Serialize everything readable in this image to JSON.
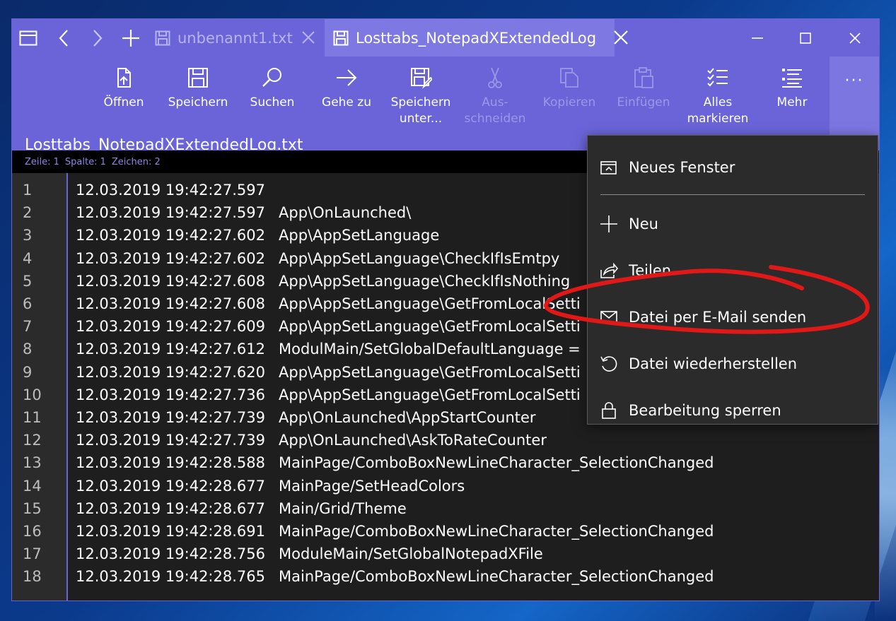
{
  "window": {
    "tabs": [
      {
        "label": "unbenannt1.txt",
        "active": false
      },
      {
        "label": "Losttabs_NotepadXExtendedLog.txt",
        "active": true
      }
    ]
  },
  "commands": [
    {
      "id": "open",
      "label": "Öffnen",
      "icon": "open-file-icon",
      "enabled": true
    },
    {
      "id": "save",
      "label": "Speichern",
      "icon": "save-icon",
      "enabled": true
    },
    {
      "id": "search",
      "label": "Suchen",
      "icon": "search-icon",
      "enabled": true
    },
    {
      "id": "goto",
      "label": "Gehe zu",
      "icon": "arrow-right-icon",
      "enabled": true
    },
    {
      "id": "saveas",
      "label": "Speichern unter...",
      "label_l1": "Speichern",
      "label_l2": "unter...",
      "icon": "save-as-icon",
      "enabled": true
    },
    {
      "id": "cut",
      "label_l1": "Aus-",
      "label_l2": "schneiden",
      "icon": "scissors-icon",
      "enabled": false
    },
    {
      "id": "copy",
      "label": "Kopieren",
      "icon": "copy-icon",
      "enabled": false
    },
    {
      "id": "paste",
      "label": "Einfügen",
      "icon": "paste-icon",
      "enabled": false
    },
    {
      "id": "selectall",
      "label_l1": "Alles",
      "label_l2": "markieren",
      "icon": "select-all-icon",
      "enabled": true
    },
    {
      "id": "more",
      "label": "Mehr",
      "icon": "list-icon",
      "enabled": true
    }
  ],
  "ghost_title": "Losttabs_NotepadXExtendedLog.txt",
  "status": {
    "line": "Zeile: 1",
    "column": "Spalte: 1",
    "chars": "Zeichen: 2"
  },
  "lines": [
    {
      "n": "1",
      "ts": "12.03.2019 19:42:27.597",
      "msg": ""
    },
    {
      "n": "2",
      "ts": "12.03.2019 19:42:27.597",
      "msg": "App\\OnLaunched\\"
    },
    {
      "n": "3",
      "ts": "12.03.2019 19:42:27.602",
      "msg": "App\\AppSetLanguage"
    },
    {
      "n": "4",
      "ts": "12.03.2019 19:42:27.602",
      "msg": "App\\AppSetLanguage\\CheckIfIsEmtpy"
    },
    {
      "n": "5",
      "ts": "12.03.2019 19:42:27.608",
      "msg": "App\\AppSetLanguage\\CheckIfIsNothing"
    },
    {
      "n": "6",
      "ts": "12.03.2019 19:42:27.608",
      "msg": "App\\AppSetLanguage\\GetFromLocalSetti"
    },
    {
      "n": "7",
      "ts": "12.03.2019 19:42:27.609",
      "msg": "App\\AppSetLanguage\\GetFromLocalSetti"
    },
    {
      "n": "8",
      "ts": "12.03.2019 19:42:27.612",
      "msg": "ModulMain/SetGlobalDefaultLanguage ="
    },
    {
      "n": "9",
      "ts": "12.03.2019 19:42:27.620",
      "msg": "App\\AppSetLanguage\\GetFromLocalSetti"
    },
    {
      "n": "10",
      "ts": "12.03.2019 19:42:27.736",
      "msg": "App\\AppSetLanguage\\GetFromLocalSetti"
    },
    {
      "n": "11",
      "ts": "12.03.2019 19:42:27.739",
      "msg": "App\\OnLaunched\\AppStartCounter"
    },
    {
      "n": "12",
      "ts": "12.03.2019 19:42:27.739",
      "msg": "App\\OnLaunched\\AskToRateCounter"
    },
    {
      "n": "13",
      "ts": "12.03.2019 19:42:28.588",
      "msg": "MainPage/ComboBoxNewLineCharacter_SelectionChanged"
    },
    {
      "n": "14",
      "ts": "12.03.2019 19:42:28.677",
      "msg": "MainPage/SetHeadColors"
    },
    {
      "n": "15",
      "ts": "12.03.2019 19:42:28.677",
      "msg": "Main/Grid/Theme"
    },
    {
      "n": "16",
      "ts": "12.03.2019 19:42:28.691",
      "msg": "MainPage/ComboBoxNewLineCharacter_SelectionChanged"
    },
    {
      "n": "17",
      "ts": "12.03.2019 19:42:28.756",
      "msg": "ModuleMain/SetGlobalNotepadXFile"
    },
    {
      "n": "18",
      "ts": "12.03.2019 19:42:28.765",
      "msg": "MainPage/ComboBoxNewLineCharacter_SelectionChanged"
    }
  ],
  "menu": {
    "items": [
      {
        "label": "Neues Fenster",
        "icon": "new-window-icon"
      },
      {
        "label": "Neu",
        "icon": "plus-icon"
      },
      {
        "label": "Teilen",
        "icon": "share-icon"
      },
      {
        "label": "Datei per E-Mail senden",
        "icon": "mail-icon"
      },
      {
        "label": "Datei wiederherstellen",
        "icon": "restore-icon"
      },
      {
        "label": "Bearbeitung sperren",
        "icon": "lock-icon"
      }
    ]
  },
  "colors": {
    "accent": "#6a64d8",
    "annotation": "#e01818"
  }
}
